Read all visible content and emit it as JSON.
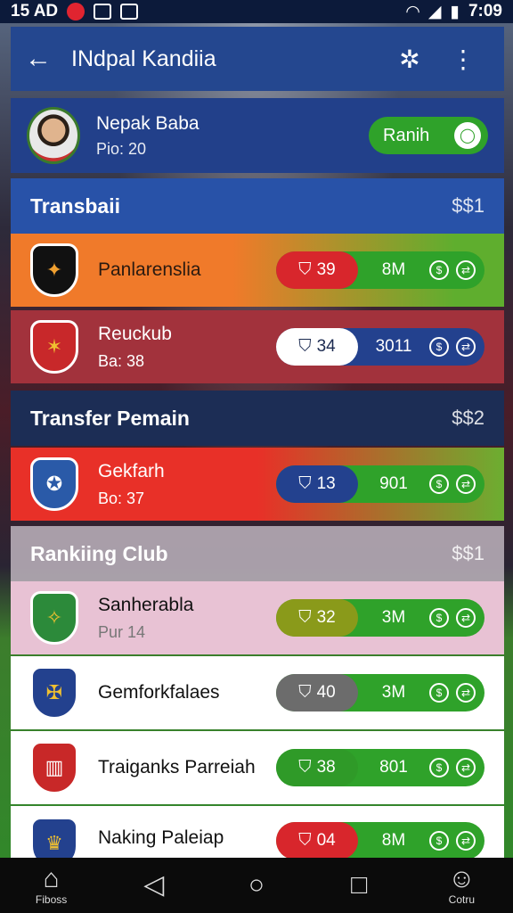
{
  "status_bar": {
    "left_text": "15 AD",
    "time": "7:09"
  },
  "app_bar": {
    "title": "INdpal Kandiia"
  },
  "profile": {
    "name": "Nepak Baba",
    "subtitle": "Pio: 20",
    "toggle_label": "Ranih"
  },
  "sections": [
    {
      "title": "Transbaii",
      "amount": "$$1"
    },
    {
      "title": "Transfer Pemain",
      "amount": "$$2"
    },
    {
      "title": "Rankiing Club",
      "amount": "$$1"
    }
  ],
  "rows": [
    {
      "name": "Panlarenslia",
      "sub": "",
      "left_value": "39",
      "mid": "8M",
      "left_color": "#d8262c"
    },
    {
      "name": "Reuckub",
      "sub": "Ba: 38",
      "left_value": "34",
      "mid": "3011",
      "left_color": "#ffffff"
    },
    {
      "name": "Gekfarh",
      "sub": "Bo: 37",
      "left_value": "13",
      "mid": "901",
      "left_color": "#23418e"
    },
    {
      "name": "Sanherabla",
      "sub": "Pur 14",
      "left_value": "32",
      "mid": "3M",
      "left_color": "#8a9a1a"
    },
    {
      "name": "Gemforkfalaes",
      "sub": "",
      "left_value": "40",
      "mid": "3M",
      "left_color": "#6c6c6c"
    },
    {
      "name": "Traiganks Parreiah",
      "sub": "",
      "left_value": "38",
      "mid": "801",
      "left_color": "#2f9a28"
    },
    {
      "name": "Naking Paleiap",
      "sub": "",
      "left_value": "04",
      "mid": "8M",
      "left_color": "#d8262c"
    }
  ],
  "nav": {
    "home_label": "Fiboss",
    "profile_label": "Cotru"
  }
}
